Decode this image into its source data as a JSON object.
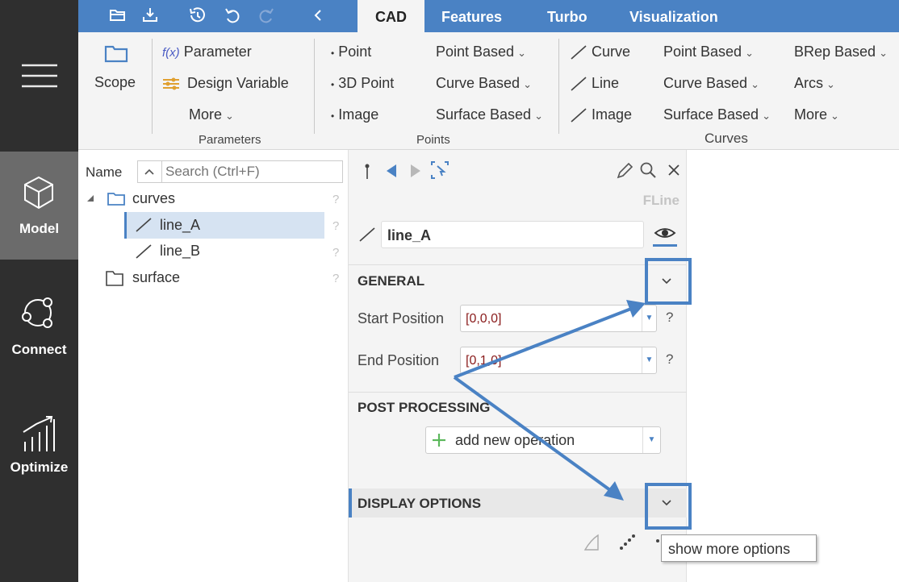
{
  "colors": {
    "accent": "#4a82c4",
    "sidebar": "#2f2f2f",
    "ribbon": "#f4f4f4"
  },
  "sidebar": {
    "items": [
      {
        "label": "Model",
        "icon": "cube-icon",
        "active": true
      },
      {
        "label": "Connect",
        "icon": "connect-icon",
        "active": false
      },
      {
        "label": "Optimize",
        "icon": "optimize-icon",
        "active": false
      }
    ]
  },
  "tabs": [
    {
      "label": "CAD",
      "active": true
    },
    {
      "label": "Features",
      "active": false
    },
    {
      "label": "Turbo",
      "active": false
    },
    {
      "label": "Visualization",
      "active": false
    }
  ],
  "ribbon": {
    "scope_label": "Scope",
    "parameter_label": "Parameter",
    "fx_label": "f(x)",
    "design_variable_label": "Design Variable",
    "params_more_label": "More",
    "parameters_caption": "Parameters",
    "points": {
      "point": "Point",
      "point3d": "3D Point",
      "image": "Image",
      "point_based": "Point Based",
      "curve_based": "Curve Based",
      "surface_based": "Surface Based",
      "caption": "Points"
    },
    "curves": {
      "curve": "Curve",
      "line": "Line",
      "image": "Image",
      "point_based": "Point Based",
      "curve_based": "Curve Based",
      "surface_based": "Surface Based",
      "brep_based": "BRep Based",
      "arcs": "Arcs",
      "more": "More",
      "caption": "Curves"
    }
  },
  "tree": {
    "name_header": "Name",
    "search_placeholder": "Search (Ctrl+F)",
    "items": [
      {
        "label": "curves",
        "type": "folder",
        "expanded": true
      },
      {
        "label": "line_A",
        "type": "line",
        "selected": true
      },
      {
        "label": "line_B",
        "type": "line",
        "selected": false
      },
      {
        "label": "surface",
        "type": "folder",
        "expanded": false
      }
    ],
    "help": "?"
  },
  "detail": {
    "type_label": "FLine",
    "name_value": "line_A",
    "general_title": "GENERAL",
    "start_label": "Start Position",
    "start_value": "[0,0,0]",
    "end_label": "End Position",
    "end_value": "[0,1,0]",
    "post_title": "POST PROCESSING",
    "add_operation_label": "add new operation",
    "display_title": "DISPLAY OPTIONS",
    "help": "?",
    "tooltip": "show more options"
  }
}
